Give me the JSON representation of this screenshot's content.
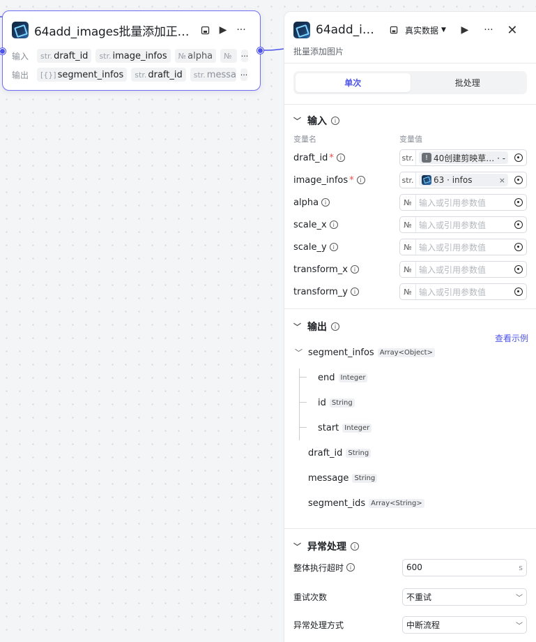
{
  "node": {
    "title": "64add_images批量添加正文…",
    "input_label": "输入",
    "output_label": "输出",
    "inputs": [
      {
        "type": "str.",
        "name": "draft_id"
      },
      {
        "type": "str.",
        "name": "image_infos"
      },
      {
        "type": "№",
        "name": "alpha"
      },
      {
        "type": "№",
        "name": ""
      }
    ],
    "outputs": [
      {
        "type": "[{}]",
        "name": "segment_infos"
      },
      {
        "type": "str.",
        "name": "draft_id"
      },
      {
        "type": "str.",
        "name": "message"
      }
    ],
    "more": "···"
  },
  "panel": {
    "title": "64add_im…",
    "data_mode": "真实数据",
    "subtitle": "批量添加图片",
    "tabs": [
      "单次",
      "批处理"
    ],
    "inputs_section": {
      "title": "输入",
      "col_name": "变量名",
      "col_value": "变量值",
      "rows": [
        {
          "name": "draft_id",
          "required": true,
          "type": "str.",
          "kind": "ref-warning",
          "value": "40创建剪映草… · -"
        },
        {
          "name": "image_infos",
          "required": true,
          "type": "str.",
          "kind": "ref-node",
          "value": "63 · infos"
        },
        {
          "name": "alpha",
          "required": false,
          "type": "№",
          "kind": "empty",
          "value": "输入或引用参数值"
        },
        {
          "name": "scale_x",
          "required": false,
          "type": "№",
          "kind": "empty",
          "value": "输入或引用参数值"
        },
        {
          "name": "scale_y",
          "required": false,
          "type": "№",
          "kind": "empty",
          "value": "输入或引用参数值"
        },
        {
          "name": "transform_x",
          "required": false,
          "type": "№",
          "kind": "empty",
          "value": "输入或引用参数值"
        },
        {
          "name": "transform_y",
          "required": false,
          "type": "№",
          "kind": "empty",
          "value": "输入或引用参数值"
        }
      ]
    },
    "outputs_section": {
      "title": "输出",
      "view_example": "查看示例",
      "tree": [
        {
          "name": "segment_infos",
          "type": "Array<Object>"
        },
        {
          "name": "end",
          "type": "Integer"
        },
        {
          "name": "id",
          "type": "String"
        },
        {
          "name": "start",
          "type": "Integer"
        },
        {
          "name": "draft_id",
          "type": "String"
        },
        {
          "name": "message",
          "type": "String"
        },
        {
          "name": "segment_ids",
          "type": "Array<String>"
        }
      ]
    },
    "error_section": {
      "title": "异常处理",
      "timeout_label": "整体执行超时",
      "timeout_value": "600",
      "timeout_unit": "s",
      "retry_label": "重试次数",
      "retry_value": "不重试",
      "mode_label": "异常处理方式",
      "mode_value": "中断流程"
    }
  },
  "colors": {
    "accent": "#4d53e8",
    "node_border": "#6f6ef2",
    "required": "#f54a45"
  }
}
